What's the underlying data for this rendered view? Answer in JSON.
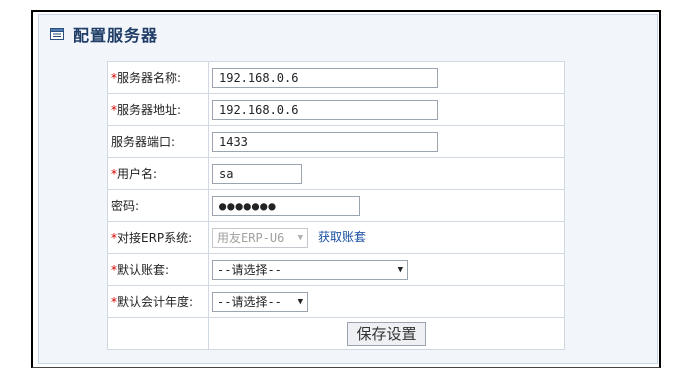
{
  "header": {
    "title": "配置服务器"
  },
  "form": {
    "server_name": {
      "label": "服务器名称:",
      "value": "192.168.0.6",
      "required": true
    },
    "server_address": {
      "label": "服务器地址:",
      "value": "192.168.0.6",
      "required": true
    },
    "server_port": {
      "label": "服务器端口:",
      "value": "1433",
      "required": false
    },
    "username": {
      "label": "用户名:",
      "value": "sa",
      "required": true
    },
    "password": {
      "label": "密码:",
      "value": "●●●●●●●",
      "required": false
    },
    "erp_system": {
      "label": "对接ERP系统:",
      "value": "用友ERP-U6",
      "required": true,
      "link": "获取账套"
    },
    "default_account": {
      "label": "默认账套:",
      "value": "--请选择--",
      "required": true
    },
    "default_fiscal_year": {
      "label": "默认会计年度:",
      "value": "--请选择--",
      "required": true
    },
    "save_label": "保存设置"
  },
  "required_mark": "*",
  "colors": {
    "title": "#1f3d66",
    "required": "#d40000",
    "link": "#1a4fa3",
    "panel_bg": "#f2f6fb"
  },
  "icons": {
    "title": "form-window-icon",
    "select_arrow": "dropdown-arrow-icon"
  }
}
